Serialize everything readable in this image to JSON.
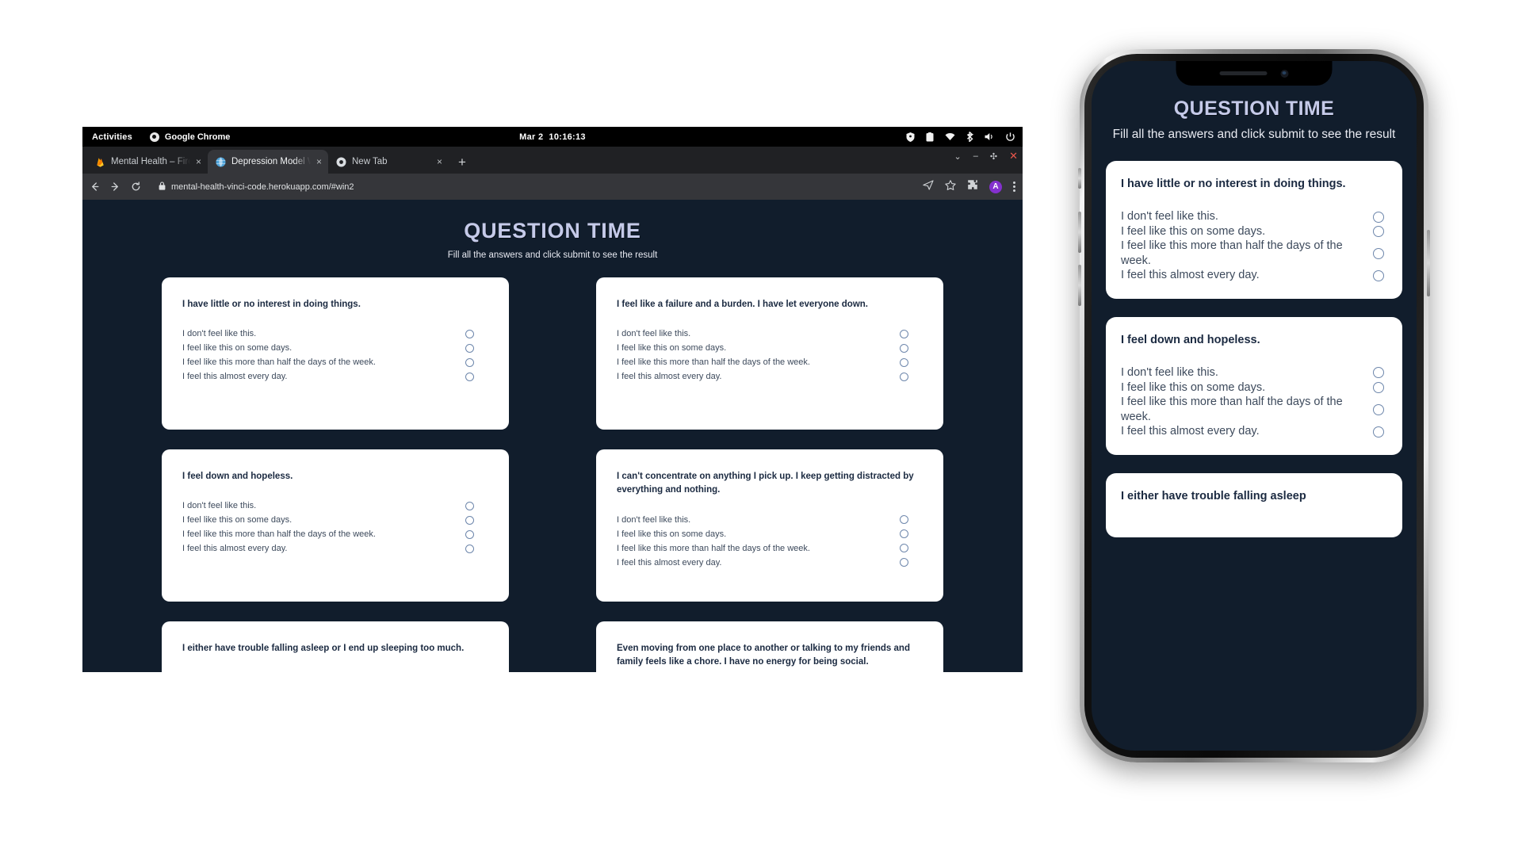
{
  "os_bar": {
    "activities": "Activities",
    "app_name": "Google Chrome",
    "clock_date": "Mar 2",
    "clock_time": "10:16:13",
    "tray_icons": [
      "shield-icon",
      "clipboard-icon",
      "wifi-icon",
      "bluetooth-icon",
      "volume-icon",
      "power-icon"
    ]
  },
  "browser": {
    "tabs": [
      {
        "title": "Mental Health – Firebase",
        "favicon": "firebase-icon",
        "active": false,
        "close": "×"
      },
      {
        "title": "Depression Model WebApp",
        "favicon": "globe-icon",
        "active": true,
        "close": "×"
      },
      {
        "title": "New Tab",
        "favicon": "chrome-icon",
        "active": false,
        "close": "×"
      }
    ],
    "new_tab_label": "+",
    "window_controls": {
      "chevron": "⌄",
      "minimize": "–",
      "maximize": "✣",
      "close": "✕"
    },
    "url": "mental-health-vinci-code.herokuapp.com/#win2",
    "lock_icon": "lock-icon",
    "back_icon": "back-arrow-icon",
    "forward_icon": "forward-arrow-icon",
    "reload_icon": "reload-icon",
    "toolbar_icons": [
      "share-icon",
      "bookmark-star-icon",
      "extensions-puzzle-icon"
    ],
    "profile_initial": "A"
  },
  "page": {
    "title": "QUESTION TIME",
    "subtitle": "Fill all the answers and click submit to see the result",
    "accent_color": "#c5cae9",
    "background_color": "#111d2c",
    "card_color": "#ffffff",
    "radio_border_color": "#6d86ab",
    "options": [
      "I don't feel like this.",
      "I feel like this on some days.",
      "I feel like this more than half the days of the week.",
      "I feel this almost every day."
    ],
    "questions": [
      "I have little or no interest in doing things.",
      "I feel like a failure and a burden. I have let everyone down.",
      "I feel down and hopeless.",
      "I can't concentrate on anything I pick up. I keep getting distracted by everything and nothing.",
      "I either have trouble falling asleep or I end up sleeping too much.",
      "Even moving from one place to another or talking to my friends and family feels like a chore. I have no energy for being social."
    ]
  },
  "phone": {
    "title": "QUESTION TIME",
    "subtitle": "Fill all the answers and click submit to see the result",
    "options": [
      "I don't feel like this.",
      "I feel like this on some days.",
      "I feel like this more than half the days of the week.",
      "I feel this almost every day."
    ],
    "questions": [
      "I have little or no interest in doing things.",
      "I feel down and hopeless.",
      "I either have trouble falling asleep"
    ]
  }
}
